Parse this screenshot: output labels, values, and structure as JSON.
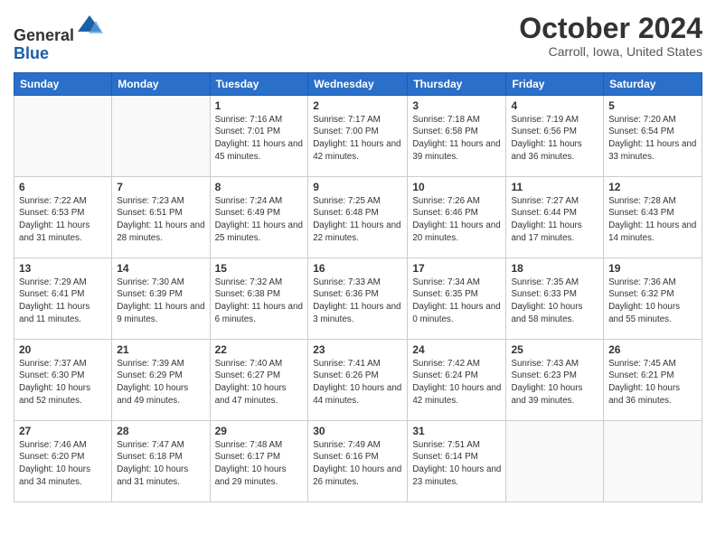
{
  "logo": {
    "general": "General",
    "blue": "Blue"
  },
  "title": "October 2024",
  "location": "Carroll, Iowa, United States",
  "days_header": [
    "Sunday",
    "Monday",
    "Tuesday",
    "Wednesday",
    "Thursday",
    "Friday",
    "Saturday"
  ],
  "weeks": [
    [
      {
        "day": "",
        "info": ""
      },
      {
        "day": "",
        "info": ""
      },
      {
        "day": "1",
        "info": "Sunrise: 7:16 AM\nSunset: 7:01 PM\nDaylight: 11 hours and 45 minutes."
      },
      {
        "day": "2",
        "info": "Sunrise: 7:17 AM\nSunset: 7:00 PM\nDaylight: 11 hours and 42 minutes."
      },
      {
        "day": "3",
        "info": "Sunrise: 7:18 AM\nSunset: 6:58 PM\nDaylight: 11 hours and 39 minutes."
      },
      {
        "day": "4",
        "info": "Sunrise: 7:19 AM\nSunset: 6:56 PM\nDaylight: 11 hours and 36 minutes."
      },
      {
        "day": "5",
        "info": "Sunrise: 7:20 AM\nSunset: 6:54 PM\nDaylight: 11 hours and 33 minutes."
      }
    ],
    [
      {
        "day": "6",
        "info": "Sunrise: 7:22 AM\nSunset: 6:53 PM\nDaylight: 11 hours and 31 minutes."
      },
      {
        "day": "7",
        "info": "Sunrise: 7:23 AM\nSunset: 6:51 PM\nDaylight: 11 hours and 28 minutes."
      },
      {
        "day": "8",
        "info": "Sunrise: 7:24 AM\nSunset: 6:49 PM\nDaylight: 11 hours and 25 minutes."
      },
      {
        "day": "9",
        "info": "Sunrise: 7:25 AM\nSunset: 6:48 PM\nDaylight: 11 hours and 22 minutes."
      },
      {
        "day": "10",
        "info": "Sunrise: 7:26 AM\nSunset: 6:46 PM\nDaylight: 11 hours and 20 minutes."
      },
      {
        "day": "11",
        "info": "Sunrise: 7:27 AM\nSunset: 6:44 PM\nDaylight: 11 hours and 17 minutes."
      },
      {
        "day": "12",
        "info": "Sunrise: 7:28 AM\nSunset: 6:43 PM\nDaylight: 11 hours and 14 minutes."
      }
    ],
    [
      {
        "day": "13",
        "info": "Sunrise: 7:29 AM\nSunset: 6:41 PM\nDaylight: 11 hours and 11 minutes."
      },
      {
        "day": "14",
        "info": "Sunrise: 7:30 AM\nSunset: 6:39 PM\nDaylight: 11 hours and 9 minutes."
      },
      {
        "day": "15",
        "info": "Sunrise: 7:32 AM\nSunset: 6:38 PM\nDaylight: 11 hours and 6 minutes."
      },
      {
        "day": "16",
        "info": "Sunrise: 7:33 AM\nSunset: 6:36 PM\nDaylight: 11 hours and 3 minutes."
      },
      {
        "day": "17",
        "info": "Sunrise: 7:34 AM\nSunset: 6:35 PM\nDaylight: 11 hours and 0 minutes."
      },
      {
        "day": "18",
        "info": "Sunrise: 7:35 AM\nSunset: 6:33 PM\nDaylight: 10 hours and 58 minutes."
      },
      {
        "day": "19",
        "info": "Sunrise: 7:36 AM\nSunset: 6:32 PM\nDaylight: 10 hours and 55 minutes."
      }
    ],
    [
      {
        "day": "20",
        "info": "Sunrise: 7:37 AM\nSunset: 6:30 PM\nDaylight: 10 hours and 52 minutes."
      },
      {
        "day": "21",
        "info": "Sunrise: 7:39 AM\nSunset: 6:29 PM\nDaylight: 10 hours and 49 minutes."
      },
      {
        "day": "22",
        "info": "Sunrise: 7:40 AM\nSunset: 6:27 PM\nDaylight: 10 hours and 47 minutes."
      },
      {
        "day": "23",
        "info": "Sunrise: 7:41 AM\nSunset: 6:26 PM\nDaylight: 10 hours and 44 minutes."
      },
      {
        "day": "24",
        "info": "Sunrise: 7:42 AM\nSunset: 6:24 PM\nDaylight: 10 hours and 42 minutes."
      },
      {
        "day": "25",
        "info": "Sunrise: 7:43 AM\nSunset: 6:23 PM\nDaylight: 10 hours and 39 minutes."
      },
      {
        "day": "26",
        "info": "Sunrise: 7:45 AM\nSunset: 6:21 PM\nDaylight: 10 hours and 36 minutes."
      }
    ],
    [
      {
        "day": "27",
        "info": "Sunrise: 7:46 AM\nSunset: 6:20 PM\nDaylight: 10 hours and 34 minutes."
      },
      {
        "day": "28",
        "info": "Sunrise: 7:47 AM\nSunset: 6:18 PM\nDaylight: 10 hours and 31 minutes."
      },
      {
        "day": "29",
        "info": "Sunrise: 7:48 AM\nSunset: 6:17 PM\nDaylight: 10 hours and 29 minutes."
      },
      {
        "day": "30",
        "info": "Sunrise: 7:49 AM\nSunset: 6:16 PM\nDaylight: 10 hours and 26 minutes."
      },
      {
        "day": "31",
        "info": "Sunrise: 7:51 AM\nSunset: 6:14 PM\nDaylight: 10 hours and 23 minutes."
      },
      {
        "day": "",
        "info": ""
      },
      {
        "day": "",
        "info": ""
      }
    ]
  ]
}
